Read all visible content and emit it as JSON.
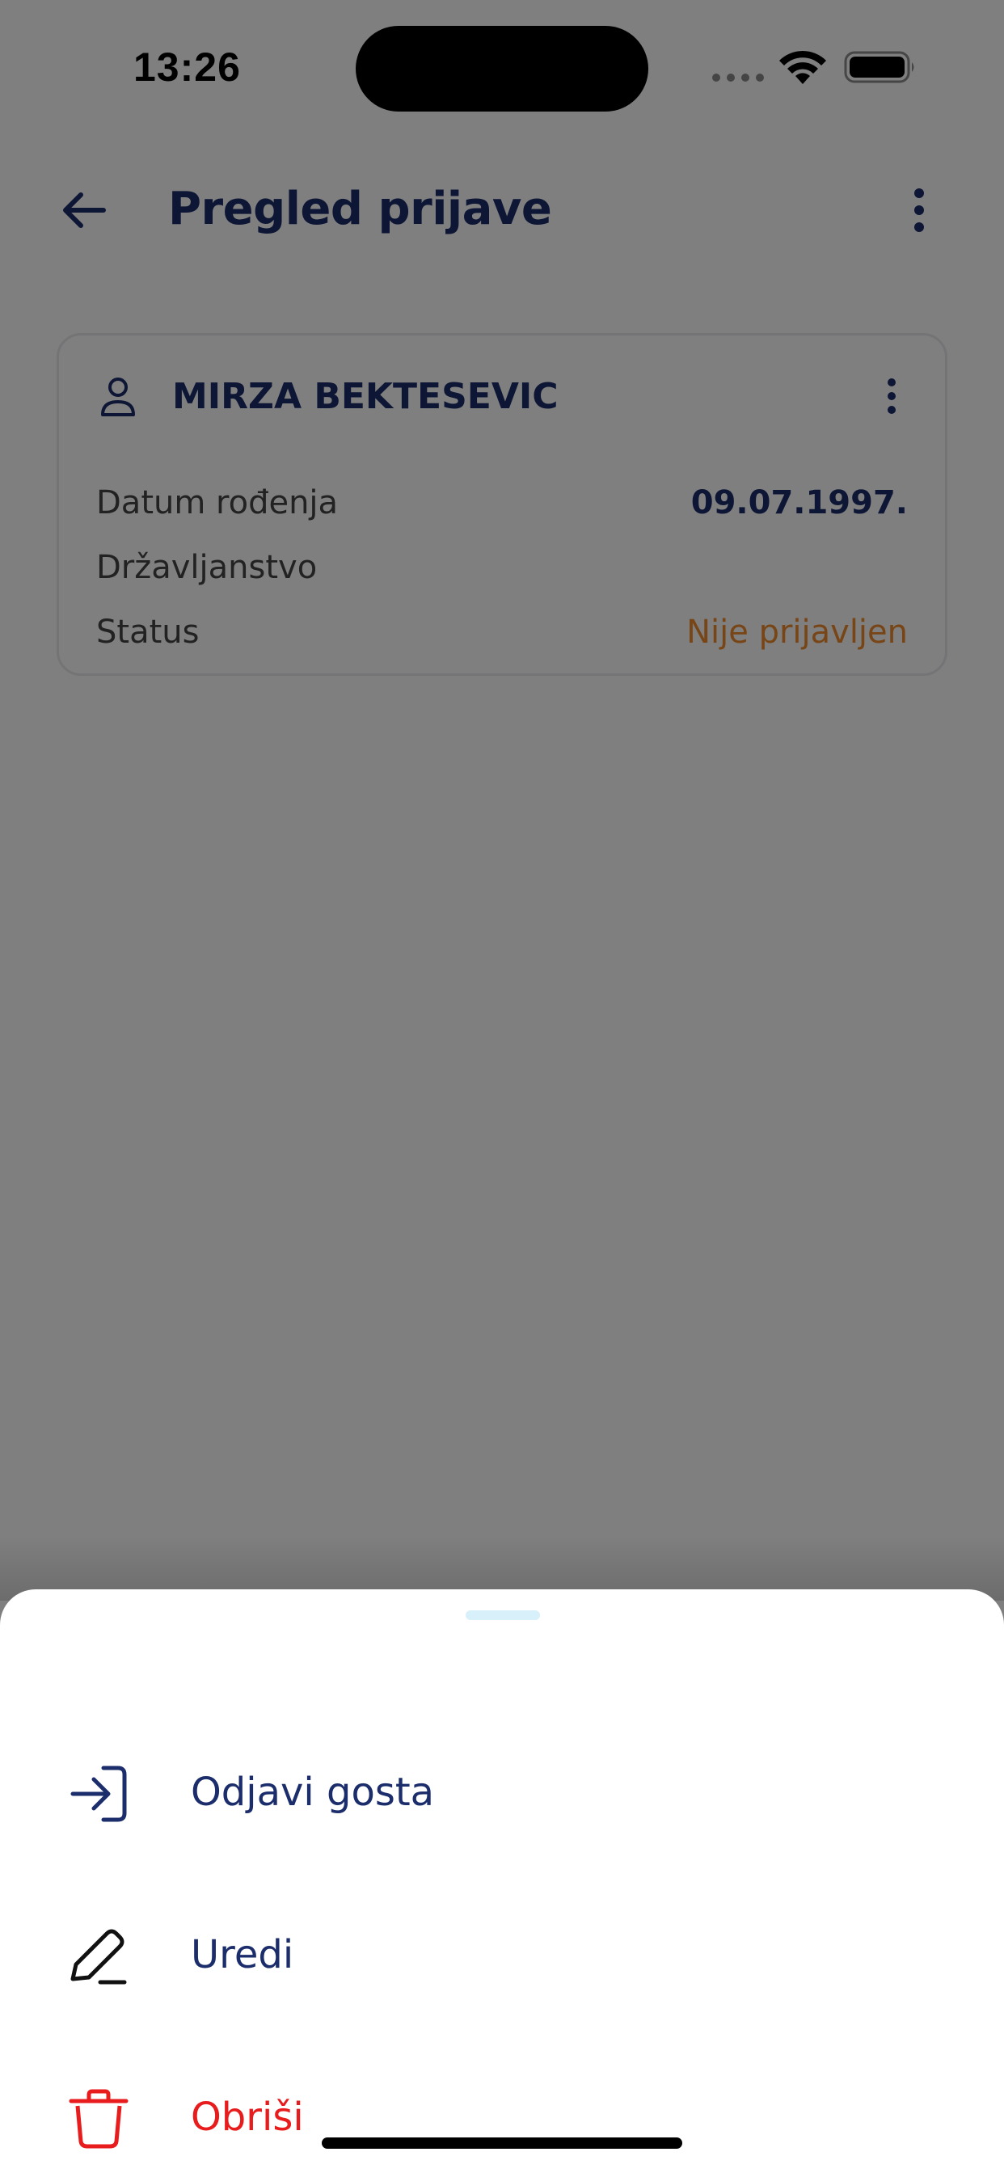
{
  "status_bar": {
    "time": "13:26",
    "icons": [
      "cellular-signal-icon",
      "wifi-icon",
      "battery-icon"
    ]
  },
  "header": {
    "title": "Pregled prijave",
    "back_icon": "arrow-left-icon",
    "more_icon": "more-vertical-icon"
  },
  "guest_card": {
    "name": "MIRZA BEKTESEVIC",
    "icon": "person-icon",
    "rows": [
      {
        "label": "Datum rođenja",
        "value": "09.07.1997."
      },
      {
        "label": "Državljanstvo",
        "value": ""
      },
      {
        "label": "Status",
        "value": "Nije prijavljen"
      }
    ]
  },
  "sheet": {
    "items": [
      {
        "label": "Odjavi gosta",
        "icon": "sign-in-arrow-icon"
      },
      {
        "label": "Uredi",
        "icon": "pencil-icon"
      },
      {
        "label": "Obriši",
        "icon": "trash-icon"
      }
    ]
  },
  "colors": {
    "primary": "#1c2d6b",
    "status_pending": "#ef8a2c",
    "danger": "#e81c1c",
    "overlay": "rgba(0,0,0,0.5)"
  }
}
